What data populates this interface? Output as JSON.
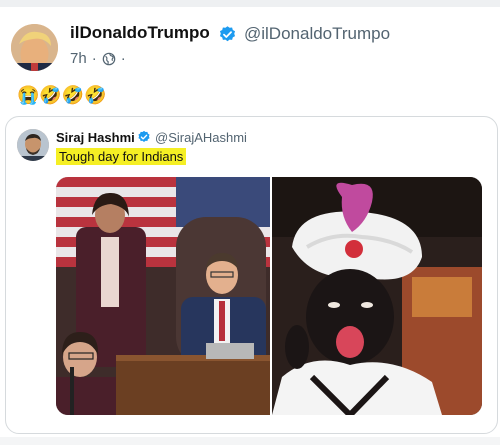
{
  "post": {
    "display_name": "ilDonaldoTrumpo",
    "handle": "@ilDonaldoTrumpo",
    "time": "7h",
    "separator": "·",
    "trailing_separator": "·",
    "emoji_text": "😭🤣🤣🤣",
    "visibility_icon": "globe-icon"
  },
  "quote": {
    "display_name": "Siraj Hashmi",
    "handle": "@SirajAHashmi",
    "text": "Tough day for Indians",
    "highlight_color": "#f5ef24"
  },
  "colors": {
    "verified": "#1d9bf0",
    "secondary_text": "#536471",
    "border": "#d6dadd"
  }
}
